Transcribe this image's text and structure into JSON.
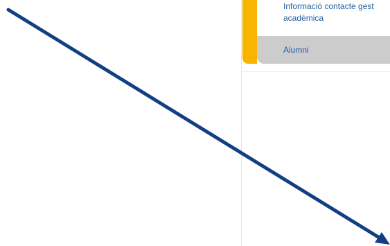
{
  "sidebar": {
    "items": [
      {
        "label_line1": "Informació contacte gest",
        "label_line2": "acadèmica"
      },
      {
        "label": "Alumni"
      }
    ]
  },
  "colors": {
    "accent": "#f7b500",
    "link": "#1f5f9e",
    "selected_bg": "#cccccc",
    "arrow": "#123f84"
  },
  "overlay": {
    "icon": "diagonal-arrow-icon"
  }
}
